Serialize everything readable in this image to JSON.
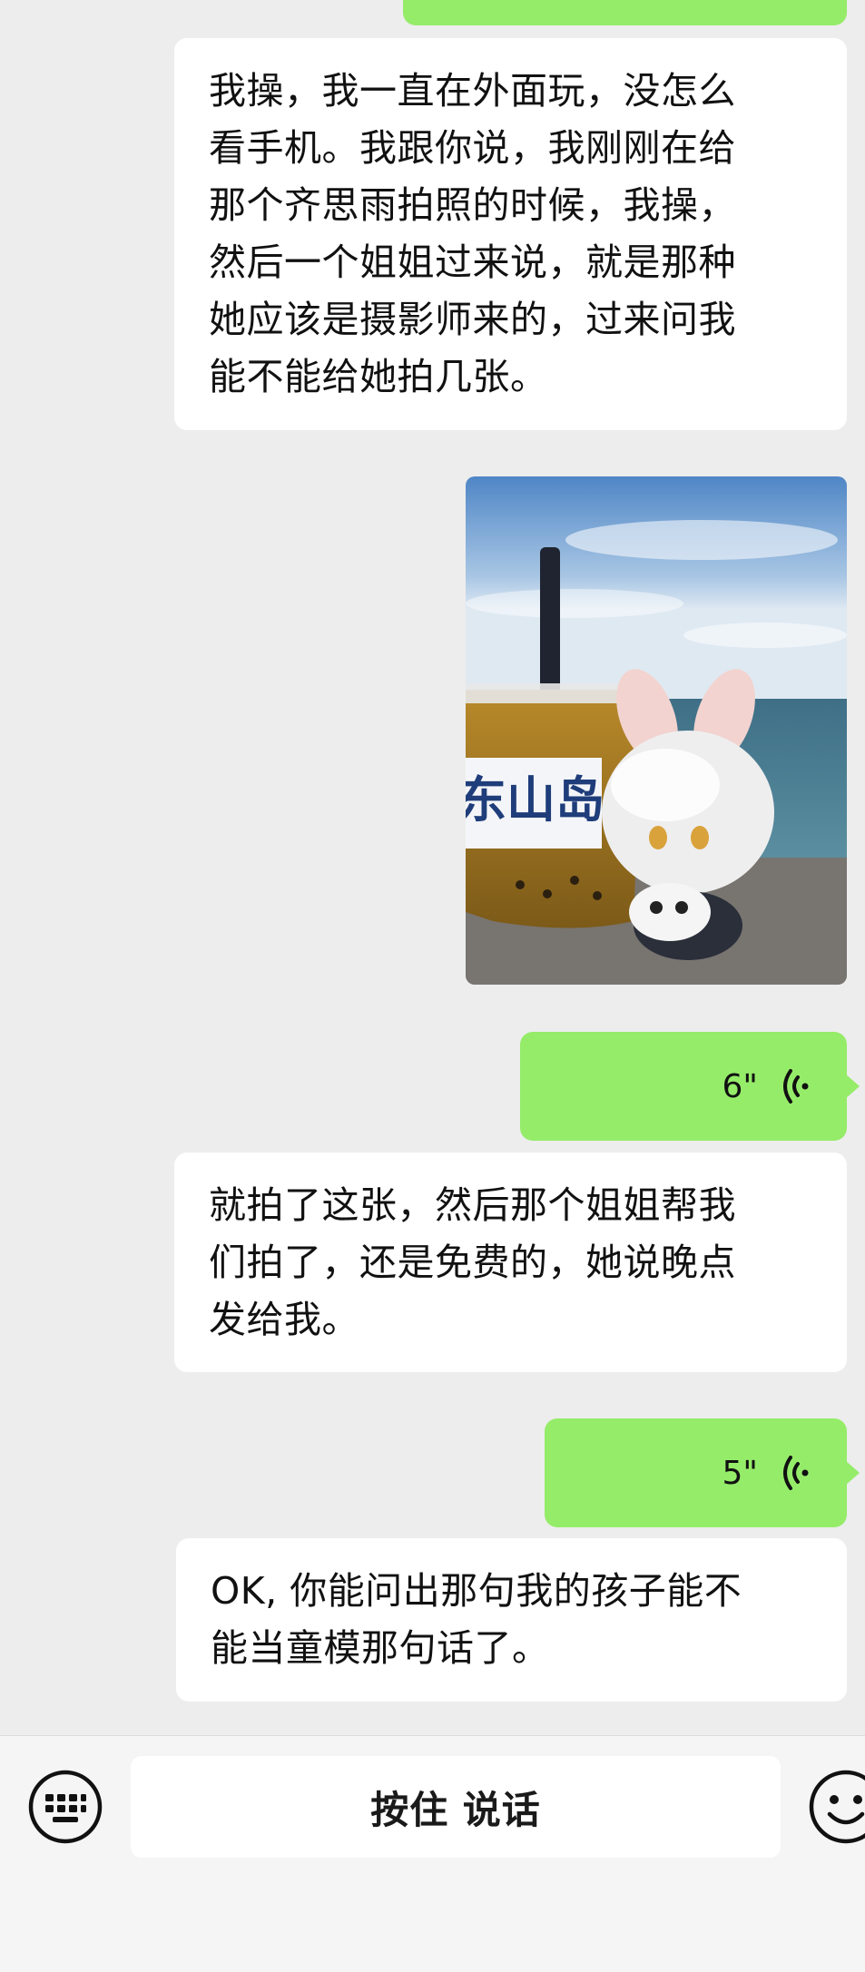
{
  "messages": [
    {
      "side": "left",
      "type": "text",
      "text": "我操，我一直在外面玩，没怎么\n看手机。我跟你说，我刚刚在给\n那个齐思雨拍照的时候，我操，\n然后一个姐姐过来说，就是那种\n她应该是摄影师来的，过来问我\n能不能给她拍几张。"
    },
    {
      "side": "right",
      "type": "image",
      "icon": "photo-milk-tea-and-plush-by-sea"
    },
    {
      "side": "right",
      "type": "voice",
      "duration": "6\""
    },
    {
      "side": "left",
      "type": "text",
      "text": "就拍了这张，然后那个姐姐帮我\n们拍了，还是免费的，她说晚点\n发给我。"
    },
    {
      "side": "right",
      "type": "voice",
      "duration": "5\""
    },
    {
      "side": "left",
      "type": "text",
      "text": "OK, 你能问出那句我的孩子能不\n能当童模那句话了。"
    }
  ],
  "photo": {
    "cup_label": "东山岛"
  },
  "input_bar": {
    "hold_to_talk_label": "按住 说话",
    "left_icon": "keyboard-icon",
    "right_icon": "emoji-icon"
  },
  "colors": {
    "background": "#ededed",
    "sent_bubble": "#95ec69",
    "received_bubble": "#ffffff",
    "input_bar": "#f5f5f5"
  }
}
